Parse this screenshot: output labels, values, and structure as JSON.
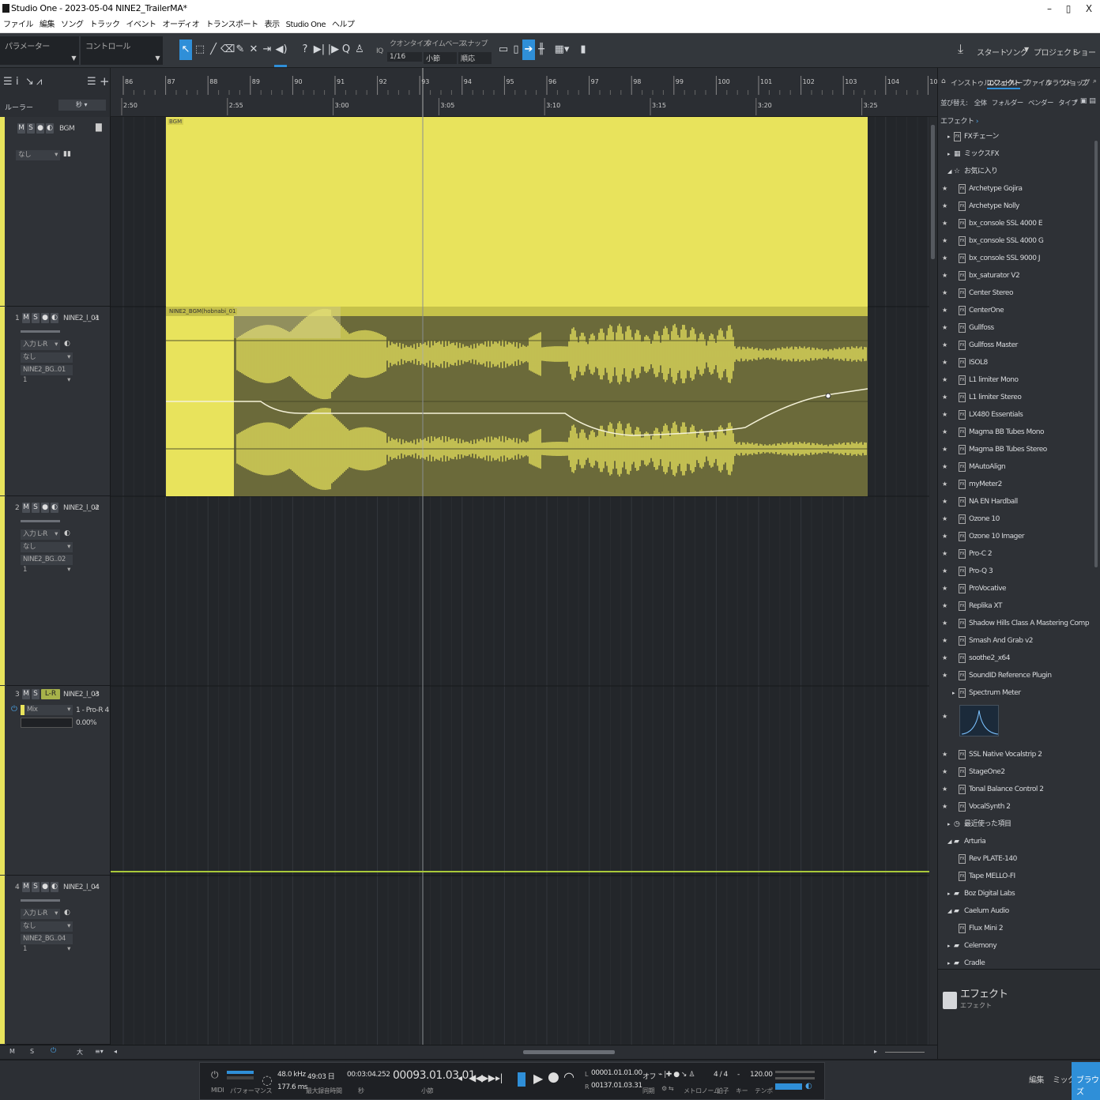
{
  "window": {
    "title": "Studio One - 2023-05-04 NINE2_TrailerMA*",
    "min": "–",
    "max": "▯",
    "close": "X"
  },
  "menu": [
    "ファイル",
    "編集",
    "ソング",
    "トラック",
    "イベント",
    "オーディオ",
    "トランスポート",
    "表示",
    "Studio One",
    "ヘルプ"
  ],
  "toolbar": {
    "param_label": "パラメーター",
    "control_label": "コントロール",
    "quantize_label": "クオンタイズ",
    "quantize_value": "1/16",
    "iq_label": "IQ",
    "timebase_label": "タイムベース",
    "timebase_value": "小節",
    "snap_label": "スナップ",
    "snap_value": "順応",
    "start": "スタート",
    "song": "ソング",
    "project": "プロジェクト",
    "show": "ショー"
  },
  "ruler": {
    "bars": [
      "86",
      "87",
      "88",
      "89",
      "90",
      "91",
      "92",
      "93",
      "94",
      "95",
      "96",
      "97",
      "98",
      "99",
      "100",
      "101",
      "102",
      "103",
      "104",
      "105"
    ],
    "times": [
      "2:50",
      "2:55",
      "3:00",
      "3:05",
      "3:10",
      "3:15",
      "3:20",
      "3:25"
    ],
    "ruler_label": "ルーラー",
    "unit": "秒"
  },
  "tracks": [
    {
      "name": "BGM",
      "num": "",
      "input": "なし",
      "type": "folder"
    },
    {
      "name": "NINE2_l_01",
      "num": "1",
      "input": "入力 L-R",
      "mon": "なし",
      "output": "NINE2_BG..01 1",
      "clip": "NINE2_BGM(hobnabi_01"
    },
    {
      "name": "NINE2_l_02",
      "num": "2",
      "input": "入力 L-R",
      "mon": "なし",
      "output": "NINE2_BG..02 1"
    },
    {
      "name": "NINE2_l_03",
      "num": "3",
      "input": "Mix",
      "output": "1 - Pro-R 4",
      "percent": "0.00%",
      "rfx": "L-R"
    },
    {
      "name": "NINE2_l_04",
      "num": "4",
      "input": "入力 L-R",
      "mon": "なし",
      "output": "NINE2_BG..04 1"
    }
  ],
  "bgm_label": "BGM",
  "bottom_strip": {
    "m": "M",
    "s": "S",
    "big": "大"
  },
  "transport": {
    "midi": "MIDI",
    "perf": "パフォーマンス",
    "rate": "48.0 kHz",
    "latency": "177.6 ms",
    "days": "49:03 日",
    "maxrec": "最大録音時間",
    "time": "00:03:04.252",
    "time_unit": "秒",
    "bars": "00093.01.03.01",
    "bars_unit": "小節",
    "L": "00001.01.01.00",
    "R": "00137.01.03.31",
    "off": "オフ",
    "sync": "同期",
    "metronome": "メトロノーム",
    "sig": "4 / 4",
    "sig_label": "拍子",
    "key": "-",
    "key_label": "キー",
    "tempo": "120.00",
    "tempo_label": "テンポ"
  },
  "browser": {
    "tabs": [
      "インストゥルメント",
      "エフェクト",
      "ループ",
      "ファイル",
      "クラウド",
      "ショップ",
      "プ"
    ],
    "sort_label": "並び替え:",
    "sort_opts": [
      "全体",
      "フォルダー",
      "ベンダー",
      "タイプ"
    ],
    "crumb": "エフェクト",
    "folders_top": [
      "FXチェーン",
      "ミックスFX",
      "お気に入り"
    ],
    "favorites": [
      "Archetype Gojira",
      "Archetype Nolly",
      "bx_console SSL 4000 E",
      "bx_console SSL 4000 G",
      "bx_console SSL 9000 J",
      "bx_saturator V2",
      "Center Stereo",
      "CenterOne",
      "Gullfoss",
      "Gullfoss Master",
      "ISOL8",
      "L1 limiter Mono",
      "L1 limiter Stereo",
      "LX480 Essentials",
      "Magma BB Tubes Mono",
      "Magma BB Tubes Stereo",
      "MAutoAlign",
      "myMeter2",
      "NA EN Hardball",
      "Ozone 10",
      "Ozone 10 Imager",
      "Pro-C 2",
      "Pro-Q 3",
      "ProVocative",
      "Replika XT",
      "Shadow Hills Class A Mastering Comp",
      "Smash And Grab v2",
      "soothe2_x64",
      "SoundID Reference Plugin",
      "Spectrum Meter"
    ],
    "favorites2": [
      "SSL Native Vocalstrip 2",
      "StageOne2",
      "Tonal Balance Control 2",
      "VocalSynth 2"
    ],
    "recent": "最近使った項目",
    "vendors": [
      {
        "name": "Arturia",
        "open": true
      },
      {
        "name": "Rev PLATE-140",
        "child": true
      },
      {
        "name": "Tape MELLO-FI",
        "child": true
      },
      {
        "name": "Boz Digital Labs",
        "open": false
      },
      {
        "name": "Caelum Audio",
        "open": true
      },
      {
        "name": "Flux Mini 2",
        "child": true
      },
      {
        "name": "Celemony",
        "open": false
      },
      {
        "name": "Cradle",
        "open": false
      }
    ],
    "footer_title": "エフェクト",
    "footer_sub": "エフェクト"
  },
  "bottom_tabs": [
    "編集",
    "ミックス",
    "ブラウズ"
  ],
  "colors": {
    "accent": "#2f8fd8",
    "track": "#e8e35c",
    "clip_dark": "#6b6a3a"
  }
}
